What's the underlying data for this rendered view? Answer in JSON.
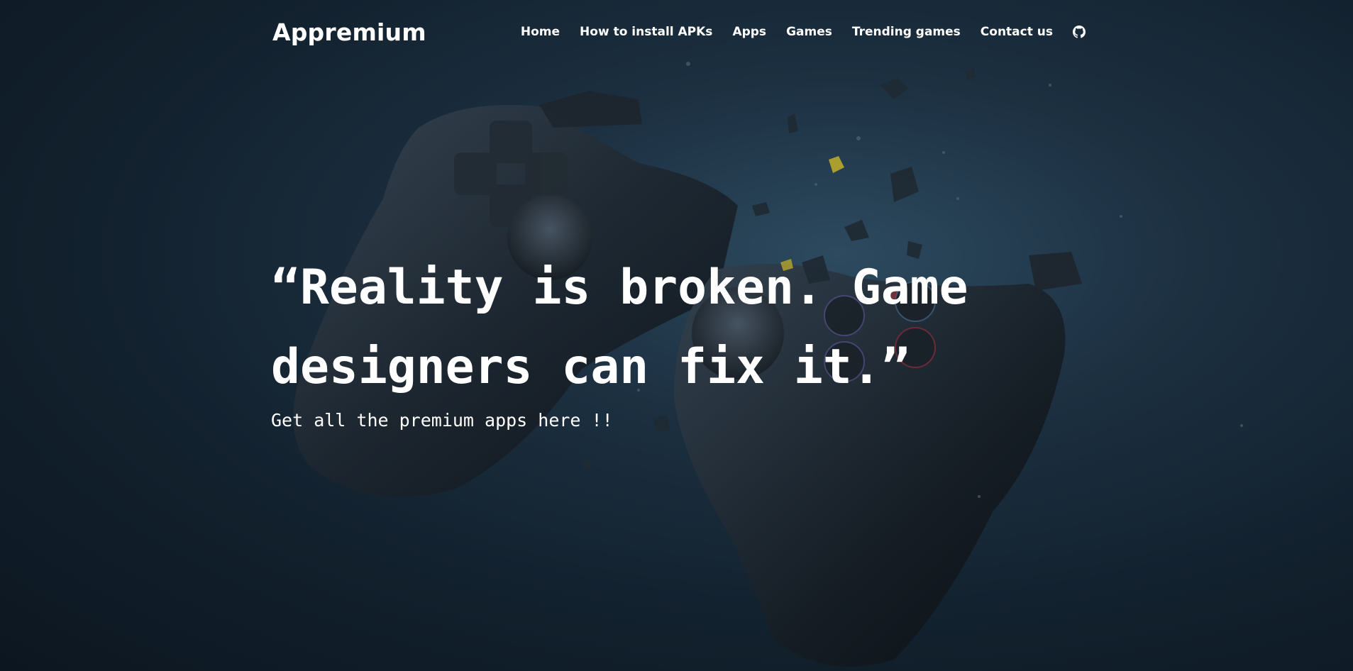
{
  "brand": {
    "name": "Appremium"
  },
  "nav": {
    "items": [
      {
        "label": "Home"
      },
      {
        "label": "How to install APKs"
      },
      {
        "label": "Apps"
      },
      {
        "label": "Games"
      },
      {
        "label": "Trending games"
      },
      {
        "label": "Contact us"
      }
    ],
    "icon": "github-icon"
  },
  "hero": {
    "quote_line1": "“Reality is broken. Game",
    "quote_line2": "designers can fix it.”",
    "tagline": "Get all the premium apps here !!",
    "background_image": "exploding-game-controller"
  },
  "colors": {
    "background": "#13222f",
    "text": "#ffffff"
  }
}
